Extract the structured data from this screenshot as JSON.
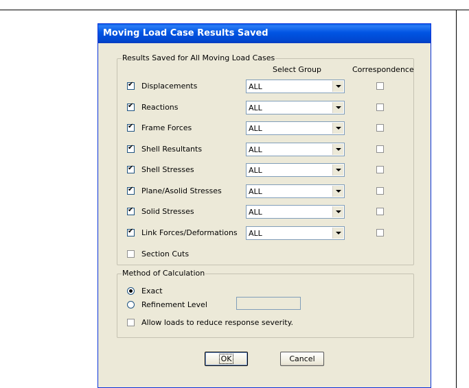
{
  "window": {
    "title": "Moving Load Case Results Saved"
  },
  "results_group": {
    "legend": "Results Saved for All Moving Load Cases",
    "col_select_group": "Select Group",
    "col_correspondence": "Correspondence",
    "rows": [
      {
        "label": "Displacements",
        "checked": true,
        "group": "ALL",
        "correspondence": false
      },
      {
        "label": "Reactions",
        "checked": true,
        "group": "ALL",
        "correspondence": false
      },
      {
        "label": "Frame Forces",
        "checked": true,
        "group": "ALL",
        "correspondence": false
      },
      {
        "label": "Shell Resultants",
        "checked": true,
        "group": "ALL",
        "correspondence": false
      },
      {
        "label": "Shell Stresses",
        "checked": true,
        "group": "ALL",
        "correspondence": false
      },
      {
        "label": "Plane/Asolid Stresses",
        "checked": true,
        "group": "ALL",
        "correspondence": false
      },
      {
        "label": "Solid Stresses",
        "checked": true,
        "group": "ALL",
        "correspondence": false
      },
      {
        "label": "Link Forces/Deformations",
        "checked": true,
        "group": "ALL",
        "correspondence": false
      }
    ],
    "section_cuts": {
      "label": "Section Cuts",
      "checked": false
    }
  },
  "method_group": {
    "legend": "Method of Calculation",
    "exact": {
      "label": "Exact",
      "selected": true
    },
    "refinement": {
      "label": "Refinement Level",
      "selected": false,
      "value": ""
    },
    "allow_reduce": {
      "label": "Allow loads to reduce response severity.",
      "checked": false
    }
  },
  "buttons": {
    "ok": "OK",
    "cancel": "Cancel"
  }
}
